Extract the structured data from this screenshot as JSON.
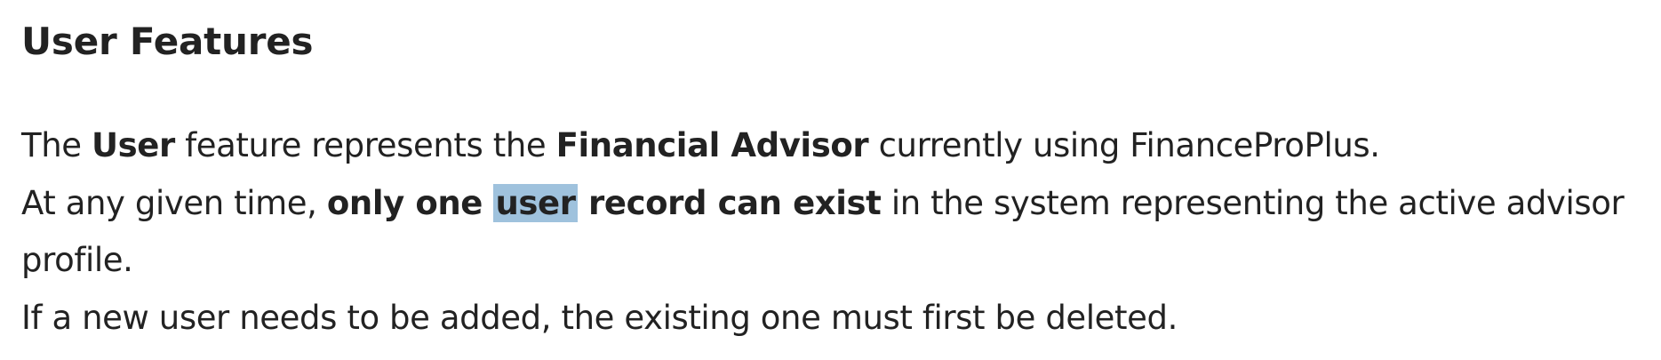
{
  "heading": "User Features",
  "paragraph": {
    "line1": {
      "t1": "The ",
      "b1": "User",
      "t2": " feature represents the ",
      "b2": "Financial Advisor",
      "t3": " currently using FinanceProPlus."
    },
    "line2": {
      "t1": "At any given time, ",
      "b1": "only one ",
      "highlight": "user",
      "b2": " record can exist",
      "t2": " in the system representing the active advisor",
      "t3": "profile."
    },
    "line3": "If a new user needs to be added, the existing one must first be deleted."
  },
  "colors": {
    "text": "#222222",
    "selection_highlight": "#9fc2dd",
    "background": "#ffffff"
  }
}
